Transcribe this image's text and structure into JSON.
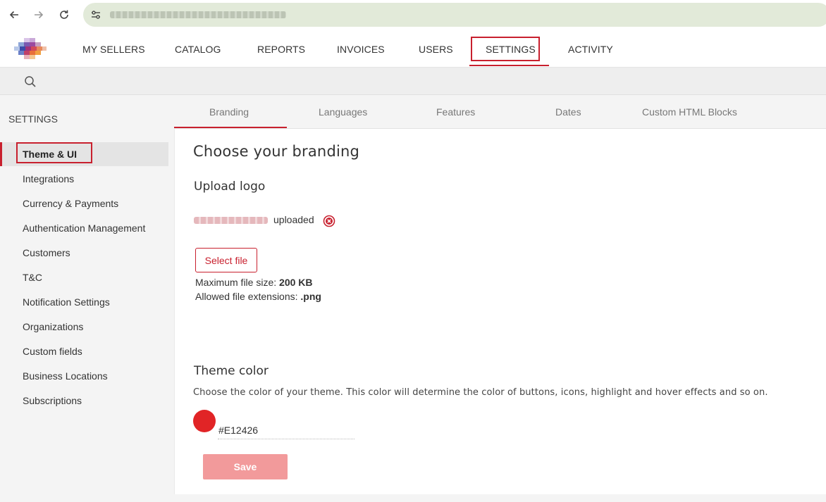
{
  "browser": {
    "back_icon": "arrow-left-icon",
    "forward_icon": "arrow-right-icon",
    "reload_icon": "reload-icon",
    "url_icon": "tune-icon"
  },
  "topnav": {
    "items": [
      "MY SELLERS",
      "CATALOG",
      "REPORTS",
      "INVOICES",
      "USERS",
      "SETTINGS",
      "ACTIVITY"
    ],
    "active": "SETTINGS"
  },
  "search": {
    "icon": "search-icon"
  },
  "sidebar": {
    "title": "SETTINGS",
    "items": [
      "Theme & UI",
      "Integrations",
      "Currency & Payments",
      "Authentication Management",
      "Customers",
      "T&C",
      "Notification Settings",
      "Organizations",
      "Custom fields",
      "Business Locations",
      "Subscriptions"
    ],
    "active": "Theme & UI"
  },
  "tabs": {
    "items": [
      "Branding",
      "Languages",
      "Features",
      "Dates",
      "Custom HTML Blocks"
    ],
    "active": "Branding"
  },
  "branding": {
    "heading": "Choose your branding",
    "upload_logo": {
      "title": "Upload logo",
      "status": "uploaded",
      "remove_icon": "remove-circle-icon",
      "select_button": "Select file",
      "max_size_label": "Maximum file size:",
      "max_size_value": "200 KB",
      "extensions_label": "Allowed file extensions:",
      "extensions_value": ".png"
    },
    "theme_color": {
      "title": "Theme color",
      "description": "Choose the color of your theme. This color will determine the color of buttons, icons, highlight and hover effects and so on.",
      "value": "#E12426",
      "swatch_color": "#E12426"
    },
    "save_button": "Save"
  },
  "colors": {
    "accent": "#C8202E",
    "save_disabled": "#F29A9B",
    "url_bar": "#E2EAD9"
  }
}
